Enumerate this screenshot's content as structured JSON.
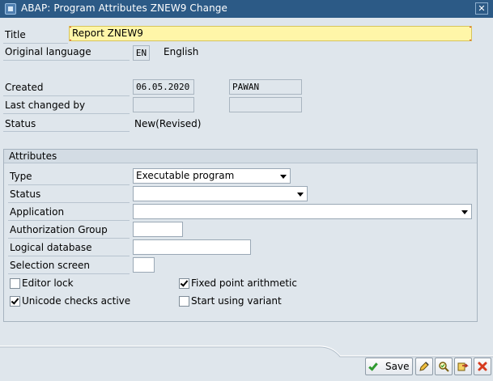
{
  "window": {
    "title": "ABAP: Program Attributes ZNEW9 Change",
    "close_glyph": "✕"
  },
  "header": {
    "title_label": "Title",
    "title_value": "Report ZNEW9",
    "orig_lang_label": "Original language",
    "orig_lang_code": "EN",
    "orig_lang_name": "English",
    "created_label": "Created",
    "created_date": "06.05.2020",
    "created_user": "PAWAN",
    "changed_label": "Last changed by",
    "changed_date": "",
    "changed_user": "",
    "status_label": "Status",
    "status_value": "New(Revised)"
  },
  "attributes": {
    "group_title": "Attributes",
    "type_label": "Type",
    "type_value": "Executable program",
    "status_label": "Status",
    "status_value": "",
    "application_label": "Application",
    "application_value": "",
    "auth_group_label": "Authorization Group",
    "auth_group_value": "",
    "logical_db_label": "Logical database",
    "logical_db_value": "",
    "selection_screen_label": "Selection screen",
    "selection_screen_value": "",
    "editor_lock_label": "Editor lock",
    "editor_lock_checked": false,
    "fixed_point_label": "Fixed point arithmetic",
    "fixed_point_checked": true,
    "unicode_label": "Unicode checks active",
    "unicode_checked": true,
    "start_variant_label": "Start using variant",
    "start_variant_checked": false
  },
  "toolbar": {
    "save_label": "Save",
    "icons": [
      "edit-pencil-icon",
      "check-magnifier-icon",
      "transfer-icon",
      "cancel-icon"
    ]
  }
}
